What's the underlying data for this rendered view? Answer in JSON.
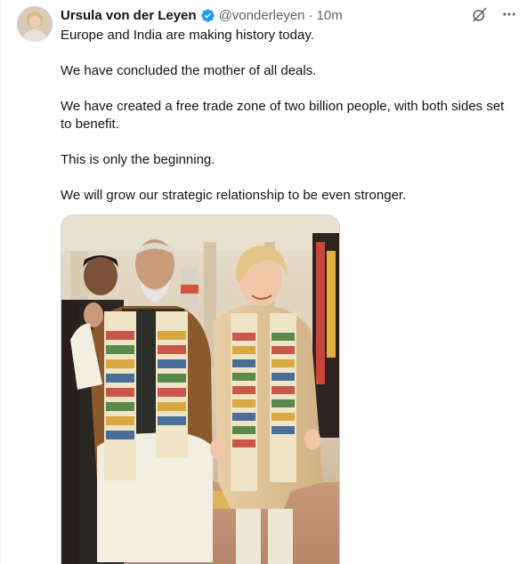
{
  "author": {
    "name": "Ursula von der Leyen",
    "handle": "@vonderleyen",
    "separator": "·",
    "timestamp": "10m",
    "verified": true
  },
  "icons": {
    "verified": "verified-badge-icon",
    "grok": "grok-icon",
    "more": "more-options-icon"
  },
  "tweet": {
    "paragraphs": [
      "Europe and India are making history today.",
      "We have concluded the mother of all deals.",
      "We have created a free trade zone of two billion people, with both sides set to benefit.",
      "This is only the beginning.",
      "We will grow our strategic relationship to be even stronger."
    ]
  },
  "colors": {
    "verified": "#1d9bf0",
    "secondary_text": "#536471",
    "primary_text": "#0f1419"
  }
}
